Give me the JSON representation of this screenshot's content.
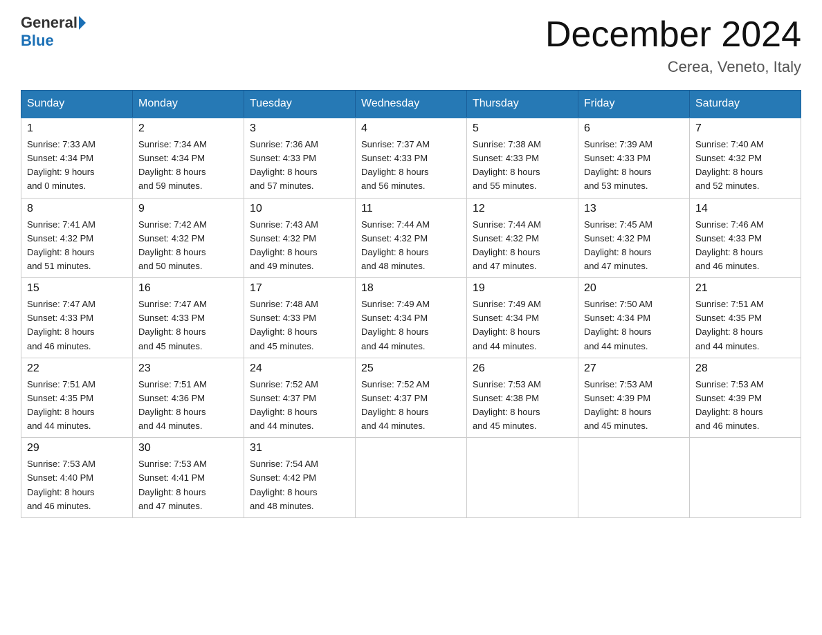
{
  "header": {
    "logo_general": "General",
    "logo_blue": "Blue",
    "month_title": "December 2024",
    "location": "Cerea, Veneto, Italy"
  },
  "days_of_week": [
    "Sunday",
    "Monday",
    "Tuesday",
    "Wednesday",
    "Thursday",
    "Friday",
    "Saturday"
  ],
  "weeks": [
    [
      {
        "day": "1",
        "sunrise": "7:33 AM",
        "sunset": "4:34 PM",
        "daylight": "9 hours and 0 minutes."
      },
      {
        "day": "2",
        "sunrise": "7:34 AM",
        "sunset": "4:34 PM",
        "daylight": "8 hours and 59 minutes."
      },
      {
        "day": "3",
        "sunrise": "7:36 AM",
        "sunset": "4:33 PM",
        "daylight": "8 hours and 57 minutes."
      },
      {
        "day": "4",
        "sunrise": "7:37 AM",
        "sunset": "4:33 PM",
        "daylight": "8 hours and 56 minutes."
      },
      {
        "day": "5",
        "sunrise": "7:38 AM",
        "sunset": "4:33 PM",
        "daylight": "8 hours and 55 minutes."
      },
      {
        "day": "6",
        "sunrise": "7:39 AM",
        "sunset": "4:33 PM",
        "daylight": "8 hours and 53 minutes."
      },
      {
        "day": "7",
        "sunrise": "7:40 AM",
        "sunset": "4:32 PM",
        "daylight": "8 hours and 52 minutes."
      }
    ],
    [
      {
        "day": "8",
        "sunrise": "7:41 AM",
        "sunset": "4:32 PM",
        "daylight": "8 hours and 51 minutes."
      },
      {
        "day": "9",
        "sunrise": "7:42 AM",
        "sunset": "4:32 PM",
        "daylight": "8 hours and 50 minutes."
      },
      {
        "day": "10",
        "sunrise": "7:43 AM",
        "sunset": "4:32 PM",
        "daylight": "8 hours and 49 minutes."
      },
      {
        "day": "11",
        "sunrise": "7:44 AM",
        "sunset": "4:32 PM",
        "daylight": "8 hours and 48 minutes."
      },
      {
        "day": "12",
        "sunrise": "7:44 AM",
        "sunset": "4:32 PM",
        "daylight": "8 hours and 47 minutes."
      },
      {
        "day": "13",
        "sunrise": "7:45 AM",
        "sunset": "4:32 PM",
        "daylight": "8 hours and 47 minutes."
      },
      {
        "day": "14",
        "sunrise": "7:46 AM",
        "sunset": "4:33 PM",
        "daylight": "8 hours and 46 minutes."
      }
    ],
    [
      {
        "day": "15",
        "sunrise": "7:47 AM",
        "sunset": "4:33 PM",
        "daylight": "8 hours and 46 minutes."
      },
      {
        "day": "16",
        "sunrise": "7:47 AM",
        "sunset": "4:33 PM",
        "daylight": "8 hours and 45 minutes."
      },
      {
        "day": "17",
        "sunrise": "7:48 AM",
        "sunset": "4:33 PM",
        "daylight": "8 hours and 45 minutes."
      },
      {
        "day": "18",
        "sunrise": "7:49 AM",
        "sunset": "4:34 PM",
        "daylight": "8 hours and 44 minutes."
      },
      {
        "day": "19",
        "sunrise": "7:49 AM",
        "sunset": "4:34 PM",
        "daylight": "8 hours and 44 minutes."
      },
      {
        "day": "20",
        "sunrise": "7:50 AM",
        "sunset": "4:34 PM",
        "daylight": "8 hours and 44 minutes."
      },
      {
        "day": "21",
        "sunrise": "7:51 AM",
        "sunset": "4:35 PM",
        "daylight": "8 hours and 44 minutes."
      }
    ],
    [
      {
        "day": "22",
        "sunrise": "7:51 AM",
        "sunset": "4:35 PM",
        "daylight": "8 hours and 44 minutes."
      },
      {
        "day": "23",
        "sunrise": "7:51 AM",
        "sunset": "4:36 PM",
        "daylight": "8 hours and 44 minutes."
      },
      {
        "day": "24",
        "sunrise": "7:52 AM",
        "sunset": "4:37 PM",
        "daylight": "8 hours and 44 minutes."
      },
      {
        "day": "25",
        "sunrise": "7:52 AM",
        "sunset": "4:37 PM",
        "daylight": "8 hours and 44 minutes."
      },
      {
        "day": "26",
        "sunrise": "7:53 AM",
        "sunset": "4:38 PM",
        "daylight": "8 hours and 45 minutes."
      },
      {
        "day": "27",
        "sunrise": "7:53 AM",
        "sunset": "4:39 PM",
        "daylight": "8 hours and 45 minutes."
      },
      {
        "day": "28",
        "sunrise": "7:53 AM",
        "sunset": "4:39 PM",
        "daylight": "8 hours and 46 minutes."
      }
    ],
    [
      {
        "day": "29",
        "sunrise": "7:53 AM",
        "sunset": "4:40 PM",
        "daylight": "8 hours and 46 minutes."
      },
      {
        "day": "30",
        "sunrise": "7:53 AM",
        "sunset": "4:41 PM",
        "daylight": "8 hours and 47 minutes."
      },
      {
        "day": "31",
        "sunrise": "7:54 AM",
        "sunset": "4:42 PM",
        "daylight": "8 hours and 48 minutes."
      },
      null,
      null,
      null,
      null
    ]
  ]
}
